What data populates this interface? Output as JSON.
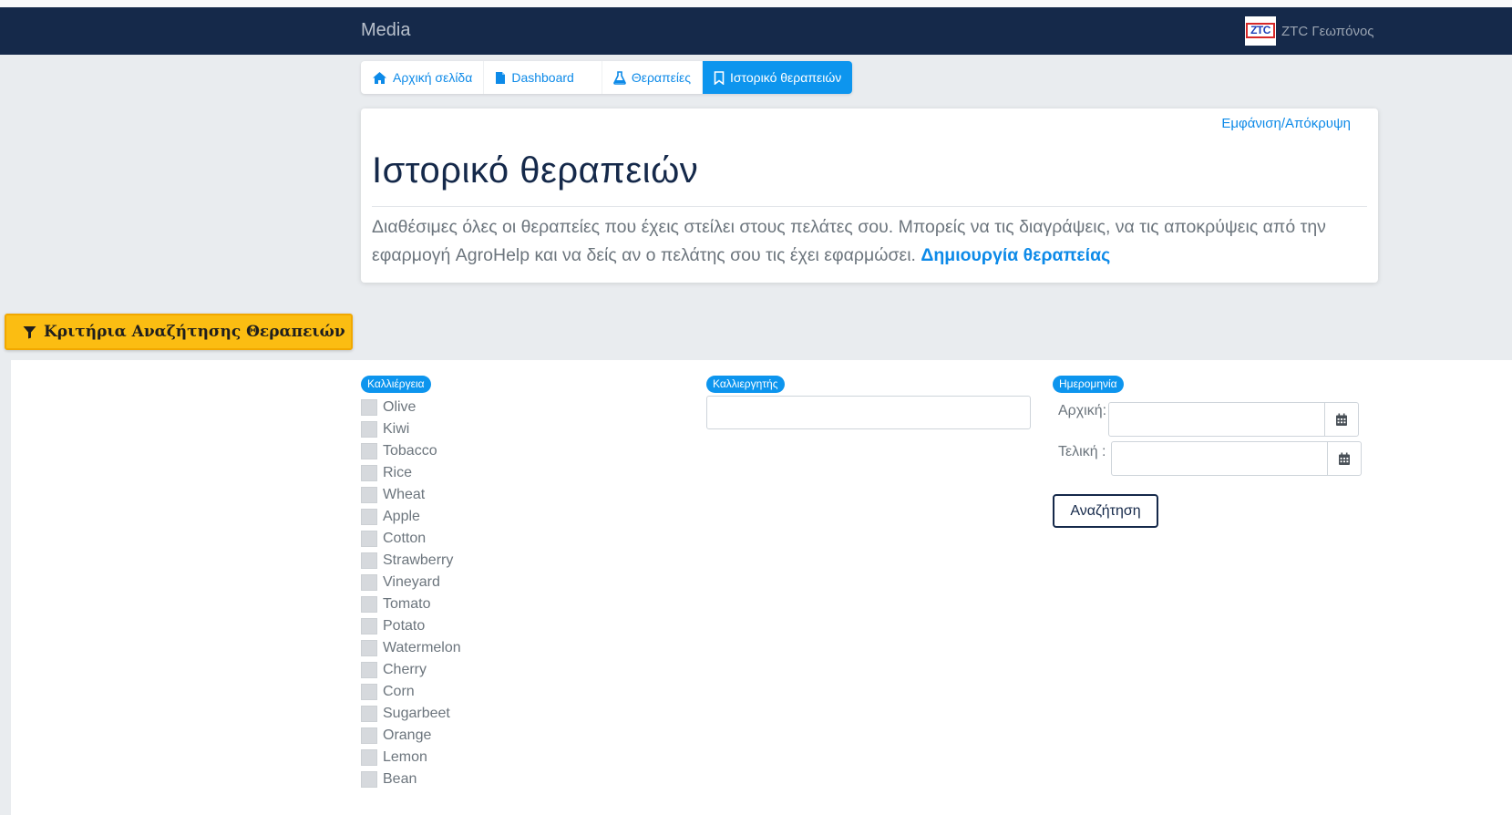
{
  "navbar": {
    "brand": "Media",
    "logo_text": "ZTC",
    "user_name": "ZTC Γεωπόνος"
  },
  "tabs": [
    {
      "label": "Αρχική σελίδα",
      "icon": "home-icon"
    },
    {
      "label": "Dashboard",
      "icon": "document-icon"
    },
    {
      "label": "Θεραπείες",
      "icon": "flask-icon"
    },
    {
      "label": "Ιστορικό θεραπειών",
      "icon": "bookmark-icon",
      "active": true
    }
  ],
  "panel": {
    "toggle_label": "Εμφάνιση/Απόκρυψη",
    "title": "Ιστορικό θεραπειών",
    "description": "Διαθέσιμες όλες οι θεραπείες που έχεις στείλει στους πελάτες σου. Μπορείς να τις διαγράψεις, να τις αποκρύψεις από την εφαρμογή AgroHelp και να δείς αν ο πελάτης σου τις έχει εφαρμώσει.",
    "create_link": "Δημιουργία θεραπείας"
  },
  "filter": {
    "button_label": "Κριτήρια Αναζήτησης Θεραπειών",
    "crop_label": "Καλλιέργεια",
    "crops": [
      "Olive",
      "Kiwi",
      "Tobacco",
      "Rice",
      "Wheat",
      "Apple",
      "Cotton",
      "Strawberry",
      "Vineyard",
      "Tomato",
      "Potato",
      "Watermelon",
      "Cherry",
      "Corn",
      "Sugarbeet",
      "Orange",
      "Lemon",
      "Bean"
    ],
    "farmer_label": "Καλλιεργητής",
    "farmer_value": "",
    "date_label": "Ημερομηνία",
    "start_label": "Αρχική:",
    "end_label": "Τελική :",
    "start_value": "",
    "end_value": "",
    "search_label": "Αναζήτηση"
  },
  "colors": {
    "navbar": "#15294a",
    "accent": "#0d95ee",
    "filter_button": "#fbbd12"
  }
}
